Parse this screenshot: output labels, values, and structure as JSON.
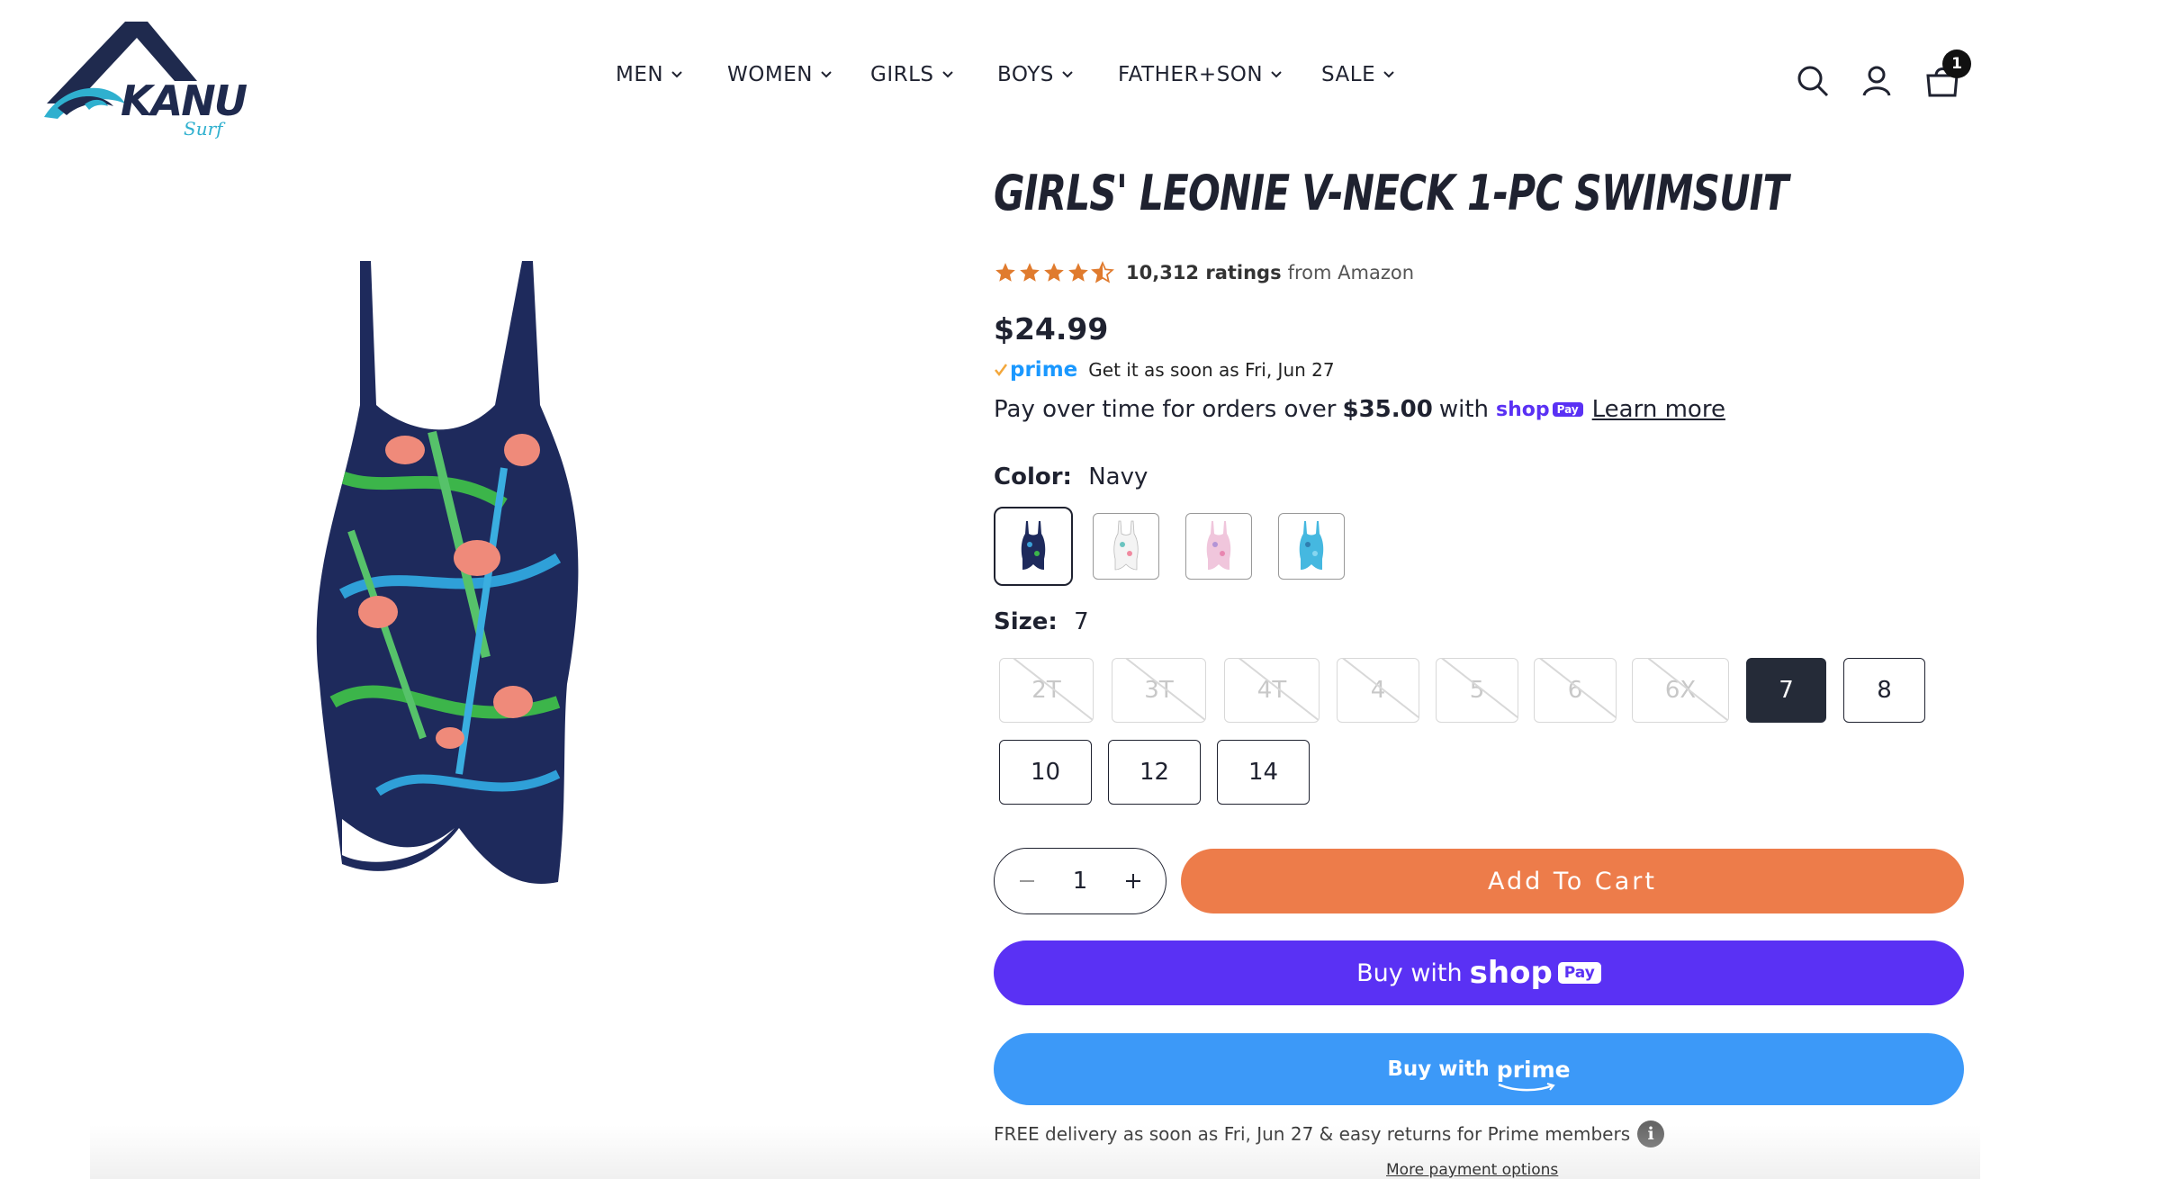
{
  "brand": {
    "name": "KANU",
    "tagline": "Surf"
  },
  "nav": {
    "items": [
      {
        "label": "MEN"
      },
      {
        "label": "WOMEN"
      },
      {
        "label": "GIRLS"
      },
      {
        "label": "BOYS"
      },
      {
        "label": "FATHER+SON"
      },
      {
        "label": "SALE"
      }
    ]
  },
  "header": {
    "cart_count": "1",
    "icons": [
      "search-icon",
      "account-icon",
      "cart-icon"
    ]
  },
  "product": {
    "title": "GIRLS' LEONIE V-NECK 1-PC SWIMSUIT",
    "rating_value": 4.5,
    "rating_count": "10,312 ratings",
    "rating_source": "from Amazon",
    "price": "$24.99",
    "prime_label": "prime",
    "prime_delivery": "Get it as soon as Fri, Jun 27",
    "payover_prefix": "Pay over time for orders over",
    "payover_amount": "$35.00",
    "payover_with": "with",
    "shop_word": "shop",
    "pay_word": "Pay",
    "learn_more": "Learn more",
    "color_label": "Color:",
    "color_value": "Navy",
    "color_swatches": [
      {
        "name": "Navy",
        "color": "#1e2a5c",
        "accent": "#3aa0d8",
        "selected": true
      },
      {
        "name": "White Floral",
        "color": "#f4f4f4",
        "accent": "#6ac4c0",
        "selected": false
      },
      {
        "name": "Pink",
        "color": "#f0c6dc",
        "accent": "#b394d6",
        "selected": false
      },
      {
        "name": "Aqua",
        "color": "#45b8e0",
        "accent": "#2f7fb0",
        "selected": false
      }
    ],
    "size_label": "Size:",
    "size_value": "7",
    "sizes": [
      {
        "label": "2T",
        "available": false
      },
      {
        "label": "3T",
        "available": false
      },
      {
        "label": "4T",
        "available": false
      },
      {
        "label": "4",
        "available": false
      },
      {
        "label": "5",
        "available": false
      },
      {
        "label": "6",
        "available": false
      },
      {
        "label": "6X",
        "available": false
      },
      {
        "label": "7",
        "available": true,
        "selected": true
      },
      {
        "label": "8",
        "available": true
      },
      {
        "label": "10",
        "available": true
      },
      {
        "label": "12",
        "available": true
      },
      {
        "label": "14",
        "available": true
      }
    ],
    "quantity": "1",
    "add_to_cart": "Add To Cart",
    "buy_with": "Buy with",
    "buy_with_prime": "prime",
    "free_delivery": "FREE delivery as soon as Fri, Jun 27 & easy returns for Prime members",
    "more_payment": "More payment options"
  },
  "colors": {
    "accent_orange": "#ed7c4a",
    "shoppay_purple": "#5a31f4",
    "prime_blue": "#3c99f8",
    "star": "#e07b2e",
    "text_dark": "#1f2230"
  }
}
